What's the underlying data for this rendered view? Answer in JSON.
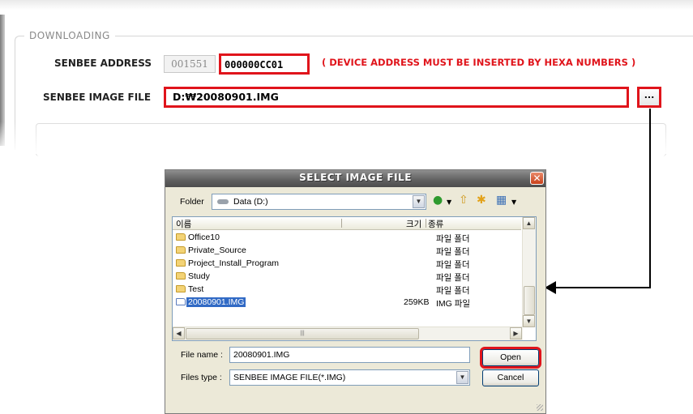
{
  "panel": {
    "group_title": "DOWNLOADING",
    "address_label": "SENBEE ADDRESS",
    "address_prefix": "001551",
    "address_value": "000000CC01",
    "address_note": "( DEVICE ADDRESS MUST BE INSERTED BY HEXA NUMBERS )",
    "image_file_label": "SENBEE IMAGE FILE",
    "image_file_value": "D:₩20080901.IMG",
    "browse_label": "..."
  },
  "dialog": {
    "title": "SELECT IMAGE FILE",
    "close_label": "✕",
    "folder_label": "Folder",
    "folder_value": "Data (D:)",
    "columns": {
      "name": "이름",
      "size": "크기",
      "type": "종류"
    },
    "rows": [
      {
        "name": "Office10",
        "size": "",
        "type": "파일 폴더",
        "icon": "folder-icon"
      },
      {
        "name": "Private_Source",
        "size": "",
        "type": "파일 폴더",
        "icon": "folder-icon"
      },
      {
        "name": "Project_Install_Program",
        "size": "",
        "type": "파일 폴더",
        "icon": "folder-icon"
      },
      {
        "name": "Study",
        "size": "",
        "type": "파일 폴더",
        "icon": "folder-icon"
      },
      {
        "name": "Test",
        "size": "",
        "type": "파일 폴더",
        "icon": "folder-icon"
      },
      {
        "name": "20080901.IMG",
        "size": "259KB",
        "type": "IMG 파일",
        "icon": "file-icon",
        "selected": true
      }
    ],
    "file_name_label": "File name :",
    "file_name_value": "20080901.IMG",
    "files_type_label": "Files type :",
    "files_type_value": "SENBEE IMAGE FILE(*.IMG)",
    "open_label": "Open",
    "cancel_label": "Cancel"
  },
  "colors": {
    "highlight": "#e0141b",
    "selection": "#316ac5"
  }
}
